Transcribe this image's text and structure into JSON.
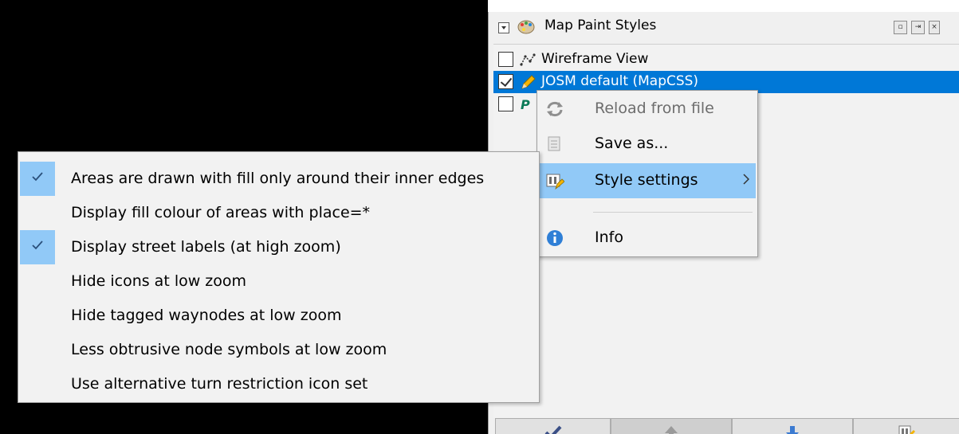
{
  "panel": {
    "title": "Map Paint Styles",
    "styles": [
      {
        "label": "Wireframe View",
        "checked": false,
        "selected": false
      },
      {
        "label": "JOSM default (MapCSS)",
        "checked": true,
        "selected": true
      },
      {
        "label": "",
        "checked": false,
        "selected": false
      }
    ]
  },
  "context_menu": {
    "items": [
      {
        "label": "Reload from file",
        "icon": "refresh-icon",
        "disabled": true
      },
      {
        "label": "Save as...",
        "icon": "save-as-icon",
        "disabled": false
      },
      {
        "label": "Style settings",
        "icon": "style-settings-icon",
        "has_submenu": true,
        "active": true
      },
      {
        "label": "Info",
        "icon": "info-icon",
        "disabled": false
      }
    ]
  },
  "style_settings_menu": {
    "items": [
      {
        "label": "Areas are drawn with fill only around their inner edges",
        "checked": true
      },
      {
        "label": "Display fill colour of areas with place=*",
        "checked": false
      },
      {
        "label": "Display street labels (at high zoom)",
        "checked": true
      },
      {
        "label": "Hide icons at low zoom",
        "checked": false
      },
      {
        "label": "Hide tagged waynodes at low zoom",
        "checked": false
      },
      {
        "label": "Less obtrusive node symbols at low zoom",
        "checked": false
      },
      {
        "label": "Use alternative turn restriction icon set",
        "checked": false
      }
    ]
  },
  "bottom_toolbar": {
    "buttons": [
      {
        "icon": "activate-check-icon"
      },
      {
        "icon": "move-up-icon"
      },
      {
        "icon": "move-down-icon"
      },
      {
        "icon": "style-preferences-icon"
      }
    ]
  },
  "colors": {
    "selection": "#0078d7",
    "menu_highlight": "#91c9f7",
    "menu_background": "#f2f2f2",
    "map_background": "#000000"
  }
}
